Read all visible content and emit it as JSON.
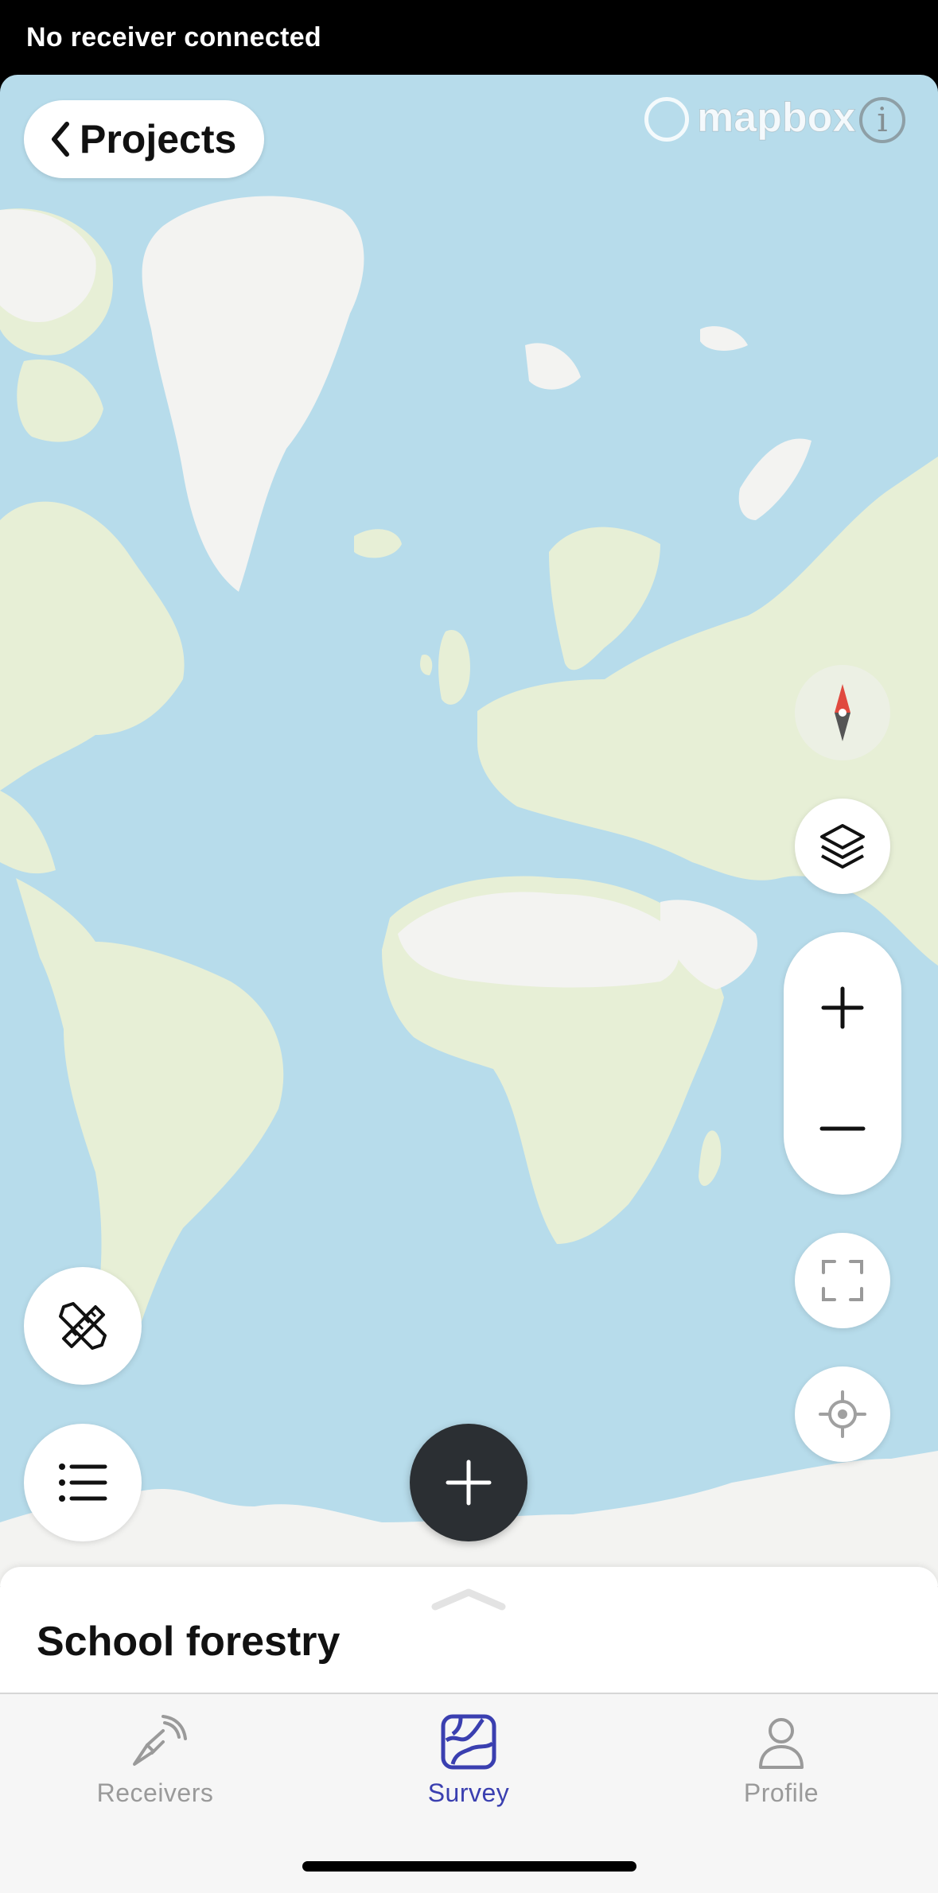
{
  "status_bar": {
    "text": "No receiver connected"
  },
  "map": {
    "back_button_label": "Projects",
    "attribution_logo": "mapbox",
    "info_icon_glyph": "i",
    "colors": {
      "water": "#b7dceb",
      "land": "#e7efd6",
      "ice": "#f3f3f1",
      "accent": "#3a3fb0",
      "add_button": "#2b2f33"
    },
    "controls": [
      "compass-icon",
      "layers-icon",
      "zoom-in-icon",
      "zoom-out-icon",
      "fullscreen-icon",
      "locate-icon",
      "measure-icon",
      "list-icon",
      "add-icon"
    ]
  },
  "sheet": {
    "project_title": "School forestry"
  },
  "tabs": [
    {
      "label": "Receivers",
      "icon": "receiver-icon",
      "active": false
    },
    {
      "label": "Survey",
      "icon": "survey-map-icon",
      "active": true
    },
    {
      "label": "Profile",
      "icon": "profile-icon",
      "active": false
    }
  ]
}
